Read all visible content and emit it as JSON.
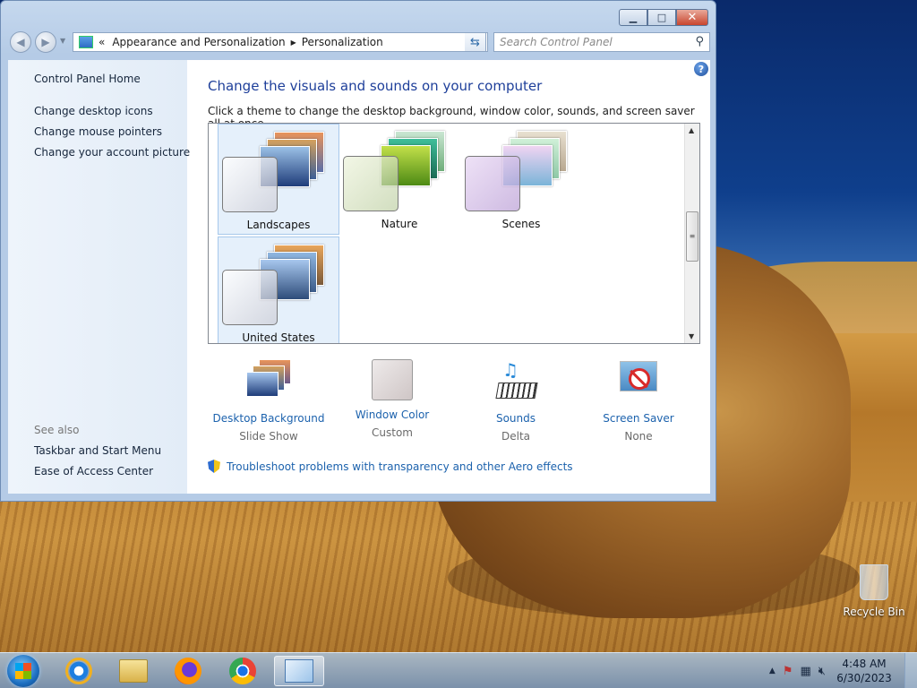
{
  "window": {
    "caption": {
      "minimize": "▁",
      "maximize": "□",
      "close": "✕"
    },
    "nav": {
      "back": "◀",
      "forward": "▶"
    },
    "address": {
      "chevron": "«",
      "crumbs": [
        "Appearance and Personalization",
        "Personalization"
      ],
      "separator": "▶"
    },
    "search_placeholder": "Search Control Panel",
    "help": "?"
  },
  "sidebar": {
    "home": "Control Panel Home",
    "links": [
      "Change desktop icons",
      "Change mouse pointers",
      "Change your account picture"
    ],
    "see_also_label": "See also",
    "see_also": [
      "Taskbar and Start Menu",
      "Ease of Access Center"
    ]
  },
  "main": {
    "title": "Change the visuals and sounds on your computer",
    "subtitle": "Click a theme to change the desktop background, window color, sounds, and screen saver all at once.",
    "themes": [
      "Landscapes",
      "Nature",
      "Scenes",
      "United States"
    ],
    "settings": [
      {
        "label": "Desktop Background",
        "value": "Slide Show"
      },
      {
        "label": "Window Color",
        "value": "Custom"
      },
      {
        "label": "Sounds",
        "value": "Delta"
      },
      {
        "label": "Screen Saver",
        "value": "None"
      }
    ],
    "troubleshoot": "Troubleshoot problems with transparency and other Aero effects"
  },
  "desktop": {
    "recycle_bin": "Recycle Bin"
  },
  "taskbar": {
    "apps": [
      "start-orb",
      "internet-explorer-icon",
      "file-explorer-icon",
      "firefox-icon",
      "chrome-icon",
      "control-panel-icon"
    ],
    "time": "4:48 AM",
    "date": "6/30/2023",
    "tray_arrow": "▲"
  },
  "colors": {
    "link": "#1c62ad",
    "title": "#1e3f9a",
    "selected_theme": "#e5f0fb"
  }
}
